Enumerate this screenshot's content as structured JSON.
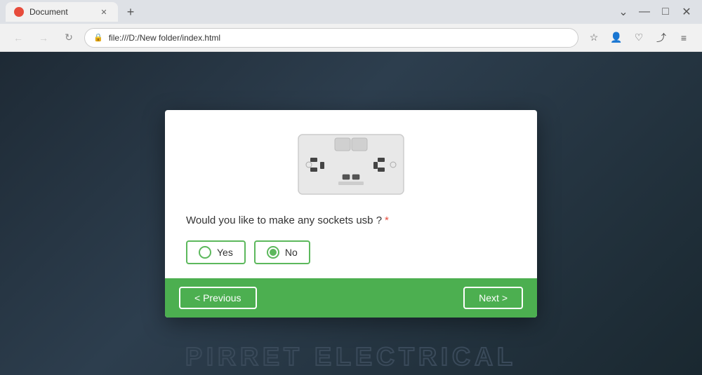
{
  "browser": {
    "tab_title": "Document",
    "tab_favicon": "●",
    "address": "file:///D:/New folder/index.html",
    "nav_back_label": "←",
    "nav_forward_label": "→",
    "nav_refresh_label": "↻",
    "minimize_label": "—",
    "maximize_label": "□",
    "close_label": "✕",
    "tab_close_label": "✕",
    "tab_new_label": "+",
    "chevron_label": "⌄",
    "bookmark_icon": "☆",
    "profile_icon": "👤",
    "heart_icon": "♡",
    "share_icon": "⤴",
    "menu_icon": "≡",
    "lock_icon": "🔒"
  },
  "modal": {
    "question": "Would you like to make any sockets usb ?",
    "required_marker": "*",
    "options": [
      {
        "label": "Yes",
        "selected": false
      },
      {
        "label": "No",
        "selected": true
      }
    ],
    "previous_label": "< Previous",
    "next_label": "Next >"
  },
  "bg": {
    "logo_text": "PIRRET ELECTRICAL"
  }
}
